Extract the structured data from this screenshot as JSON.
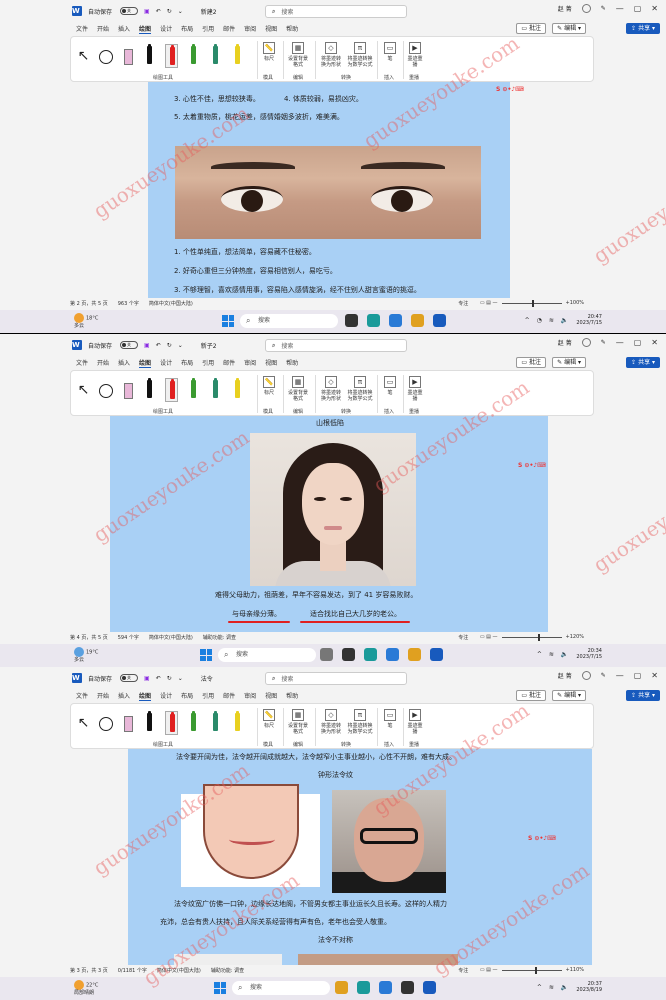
{
  "word": {
    "autosave": "自动保存",
    "toggle": "关",
    "search_placeholder": "搜索",
    "user": "赵 菁",
    "tabs": [
      "文件",
      "开始",
      "插入",
      "绘图",
      "设计",
      "布局",
      "引用",
      "邮件",
      "审阅",
      "视图",
      "帮助"
    ],
    "comment": "批注",
    "edit": "编辑",
    "share": "共享",
    "ribbon": {
      "draw_tools": "绘图工具",
      "ruler": "标尺",
      "background": "设置背景格式",
      "ink_to_shape": "将墨迹转换为形状",
      "ink_to_math": "将墨迹转换为数学公式",
      "pen": "笔",
      "replay": "墨迹重播",
      "group_stencil": "模具",
      "group_edit": "编辑",
      "group_convert": "转换",
      "group_insert": "插入",
      "group_replay": "重播"
    },
    "status_insert": "辅助功能: 调查",
    "status_lang": "简体中文(中国大陆)",
    "focus": "专注"
  },
  "shots": [
    {
      "doc_title": "新建2",
      "lines": [
        "3. 心性不佳，思想较狭毒。",
        "4. 体质较弱，易损凶灾。",
        "5. 太着重物质，桃花运差，感情婚姻多波折，难美满。",
        "1. 个性单纯直，想法简单，容易藏不住秘密。",
        "2. 好奇心重但三分钟热度，容易相信别人，易吃亏。",
        "3. 不够理智，喜欢感情用事，容易陷入感情旋涡，经不住别人甜言蜜语的挑逗。"
      ],
      "page": "第 2 页，共 5 页",
      "words": "963 个字",
      "zoom": "100%",
      "zoom_pct": 0.5,
      "weather_temp": "18°C",
      "weather_desc": "多云",
      "time": "20:47",
      "date": "2023/7/15"
    },
    {
      "doc_title": "新子2",
      "lines": [
        "山根低陷",
        "难得父母助力，祖荫差，早年不容易发达，到了 41 岁容易败财。",
        "与母亲缘分薄。",
        "适合找比自己大几岁的老公。"
      ],
      "page": "第 4 页，共 5 页",
      "words": "594 个字",
      "zoom": "120%",
      "zoom_pct": 0.6,
      "weather_temp": "19°C",
      "weather_desc": "多云",
      "time": "20:34",
      "date": "2023/7/15"
    },
    {
      "doc_title": "法令",
      "lines": [
        "法令要开阔为佳，法令越开阔成就越大，法令越窄小主事业越小，心性不开朗，难有大成。",
        "钟形法令纹",
        "法令纹宽广仿佛一口钟，边缘长达地阁，不管男女都主事业运长久且长寿。这样的人精力",
        "充沛，总会有贵人扶持，且人际关系经营得有声有色，老年也会受人敬重。",
        "法令不对称"
      ],
      "page": "第 3 页，共 3 页",
      "words": "0/1181 个字",
      "zoom": "110%",
      "zoom_pct": 0.55,
      "weather_temp": "22°C",
      "weather_desc": "局部晴朗",
      "time": "20:37",
      "date": "2023/8/19"
    }
  ],
  "watermark": "guoxueyouke.com",
  "taskbar_search": "搜索",
  "colors": {
    "accent": "#185abd",
    "doc_bg": "#a9d0f5",
    "underline": "#e02020"
  }
}
